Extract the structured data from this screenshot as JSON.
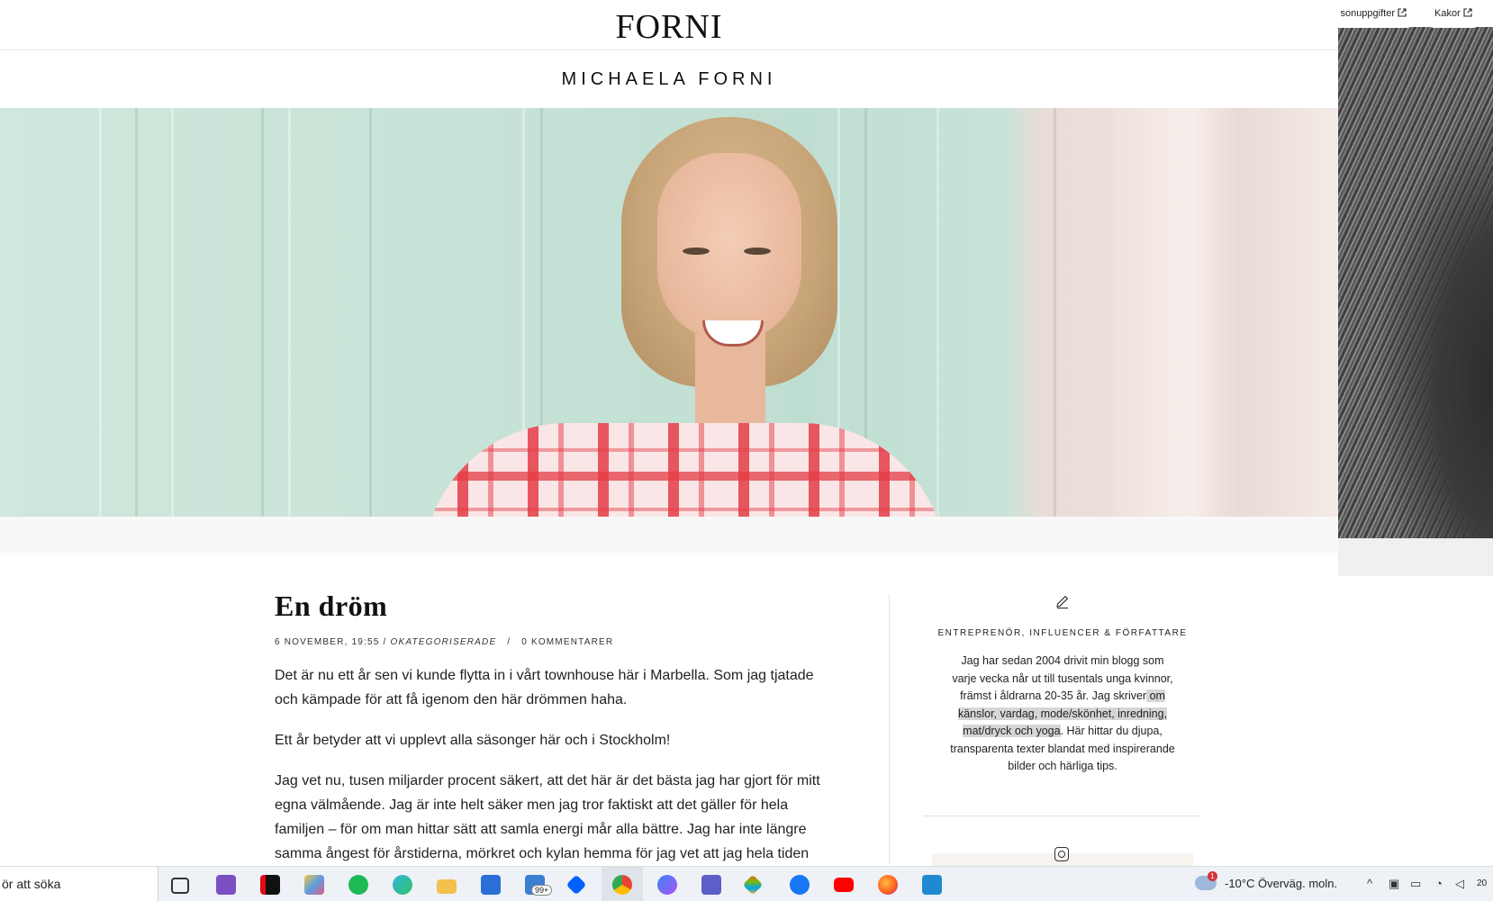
{
  "header": {
    "logo": "FORNI",
    "blog_title": "MICHAELA FORNI"
  },
  "post": {
    "title": "En dröm",
    "date": "6 NOVEMBER, 19:55 /",
    "category": "OKATEGORISERADE",
    "separator": "/",
    "comments": "0 KOMMENTARER",
    "paragraphs": [
      "Det är nu ett år sen vi kunde flytta in i vårt townhouse här i Marbella. Som jag tjatade och kämpade för att få igenom den här drömmen haha.",
      "Ett år betyder att vi upplevt alla säsonger här och i Stockholm!",
      "Jag vet nu, tusen miljarder procent säkert, att det här är det bästa jag har gjort för mitt egna välmående. Jag är inte helt säker men jag tror faktiskt att det gäller för hela familjen – för om man hittar sätt att samla energi mår alla bättre. Jag har inte längre samma ångest för årstiderna, mörkret och kylan hemma för jag vet att jag hela tiden"
    ]
  },
  "sidebar": {
    "title": "ENTREPRENÖR, INFLUENCER & FÖRFATTARE",
    "text_before": "Jag har sedan 2004 drivit min blogg som varje vecka når ut till tusentals unga kvinnor, främst i åldrarna 20-35 år. Jag skriver",
    "text_highlight": " om känslor, vardag, mode/skönhet, inredning, mat/dryck och yoga",
    "text_after": ". Här hittar du djupa, transparenta texter blandat med inspirerande bilder och härliga tips."
  },
  "right_pane": {
    "link_left": "sonuppgifter",
    "link_right": "Kakor"
  },
  "taskbar": {
    "search_placeholder": "ör att söka",
    "mail_badge": "99+",
    "weather_badge": "1",
    "weather": "-10°C  Överväg. moln.",
    "clock_partial": "20"
  },
  "colors": {
    "hero_mint": "#c6e2d6",
    "dress_red": "#e43c46",
    "highlight": "#d6d6d6"
  }
}
